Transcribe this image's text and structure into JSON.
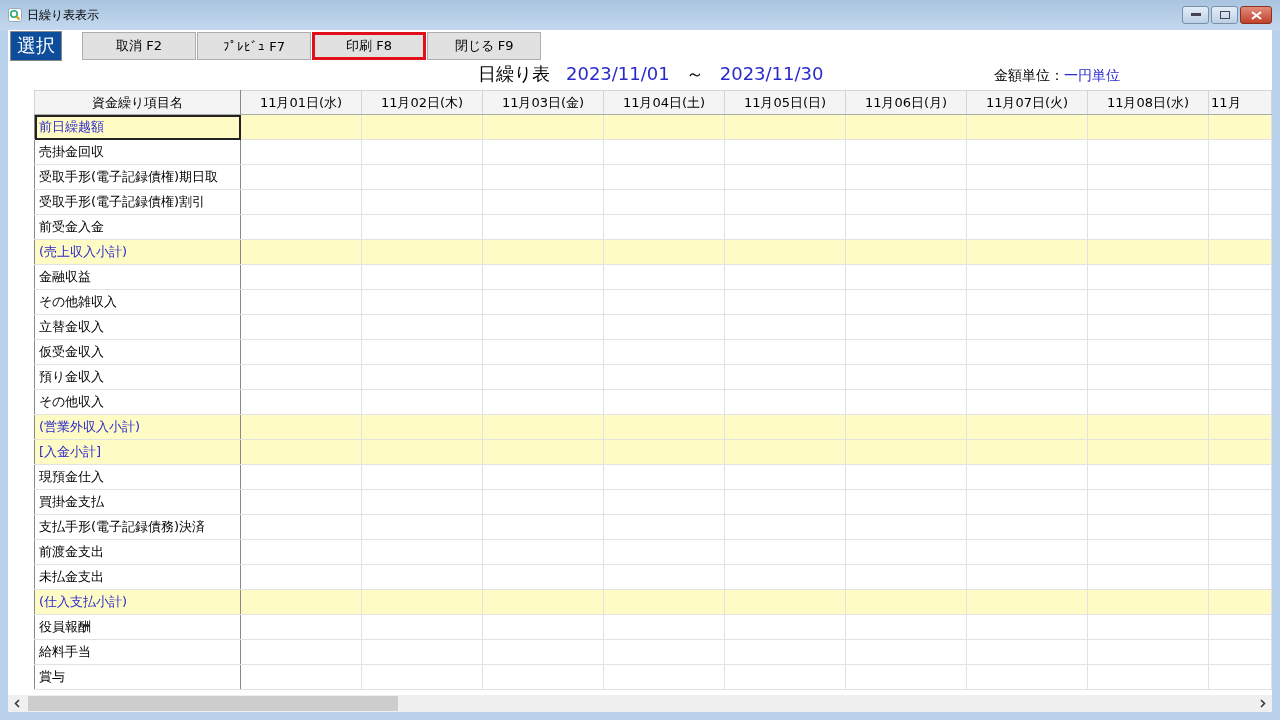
{
  "window": {
    "title": "日繰り表表示"
  },
  "mode_label": "選択",
  "buttons": [
    {
      "label": "取消 F2",
      "focused": false
    },
    {
      "label": "ﾌﾟﾚﾋﾞｭ F7",
      "focused": false
    },
    {
      "label": "印刷 F8",
      "focused": true
    },
    {
      "label": "閉じる F9",
      "focused": false
    }
  ],
  "report": {
    "title": "日繰り表",
    "date_from": "2023/11/01",
    "separator": "～",
    "date_to": "2023/11/30",
    "unit_label": "金額単位：",
    "unit_value": "一円単位"
  },
  "table": {
    "columns": [
      "資金繰り項目名",
      "11月01日(水)",
      "11月02日(木)",
      "11月03日(金)",
      "11月04日(土)",
      "11月05日(日)",
      "11月06日(月)",
      "11月07日(火)",
      "11月08日(水)",
      "11月"
    ],
    "rows": [
      {
        "name": "前日繰越額",
        "kind": "subtotal",
        "selected": true
      },
      {
        "name": "売掛金回収",
        "kind": "item",
        "selected": false
      },
      {
        "name": "受取手形(電子記録債権)期日取",
        "kind": "item",
        "selected": false
      },
      {
        "name": "受取手形(電子記録債権)割引",
        "kind": "item",
        "selected": false
      },
      {
        "name": "前受金入金",
        "kind": "item",
        "selected": false
      },
      {
        "name": "(売上収入小計)",
        "kind": "subtotal",
        "selected": false
      },
      {
        "name": "金融収益",
        "kind": "item",
        "selected": false
      },
      {
        "name": "その他雑収入",
        "kind": "item",
        "selected": false
      },
      {
        "name": "立替金収入",
        "kind": "item",
        "selected": false
      },
      {
        "name": "仮受金収入",
        "kind": "item",
        "selected": false
      },
      {
        "name": "預り金収入",
        "kind": "item",
        "selected": false
      },
      {
        "name": "その他収入",
        "kind": "item",
        "selected": false
      },
      {
        "name": "(営業外収入小計)",
        "kind": "subtotal",
        "selected": false
      },
      {
        "name": " [入金小計]",
        "kind": "subtotal",
        "selected": false
      },
      {
        "name": "現預金仕入",
        "kind": "item",
        "selected": false
      },
      {
        "name": "買掛金支払",
        "kind": "item",
        "selected": false
      },
      {
        "name": "支払手形(電子記録債務)決済",
        "kind": "item",
        "selected": false
      },
      {
        "name": "前渡金支出",
        "kind": "item",
        "selected": false
      },
      {
        "name": "未払金支出",
        "kind": "item",
        "selected": false
      },
      {
        "name": "(仕入支払小計)",
        "kind": "subtotal",
        "selected": false
      },
      {
        "name": "役員報酬",
        "kind": "item",
        "selected": false
      },
      {
        "name": "給料手当",
        "kind": "item",
        "selected": false
      },
      {
        "name": "賞与",
        "kind": "item",
        "selected": false
      }
    ]
  }
}
